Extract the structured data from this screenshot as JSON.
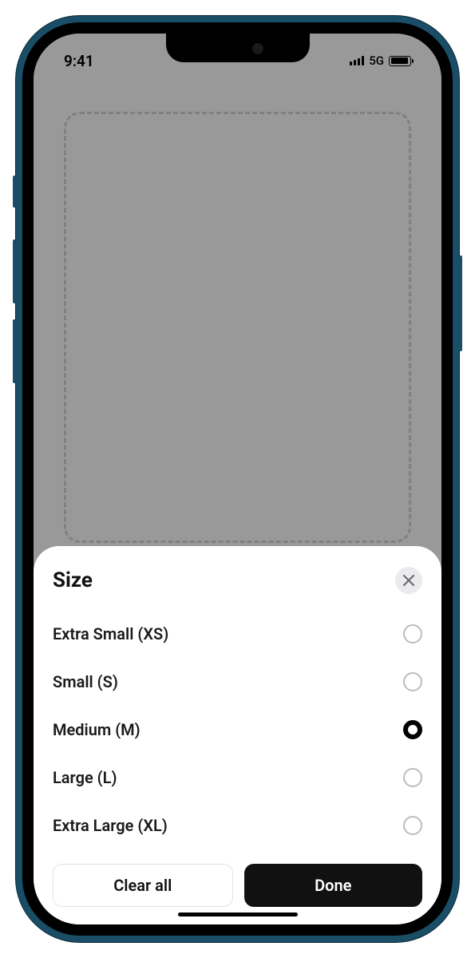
{
  "status": {
    "time": "9:41",
    "network": "5G"
  },
  "sheet": {
    "title": "Size",
    "options": [
      {
        "label": "Extra Small (XS)",
        "selected": false
      },
      {
        "label": "Small (S)",
        "selected": false
      },
      {
        "label": "Medium (M)",
        "selected": true
      },
      {
        "label": "Large (L)",
        "selected": false
      },
      {
        "label": "Extra Large (XL)",
        "selected": false
      }
    ],
    "actions": {
      "clear": "Clear all",
      "done": "Done"
    }
  }
}
